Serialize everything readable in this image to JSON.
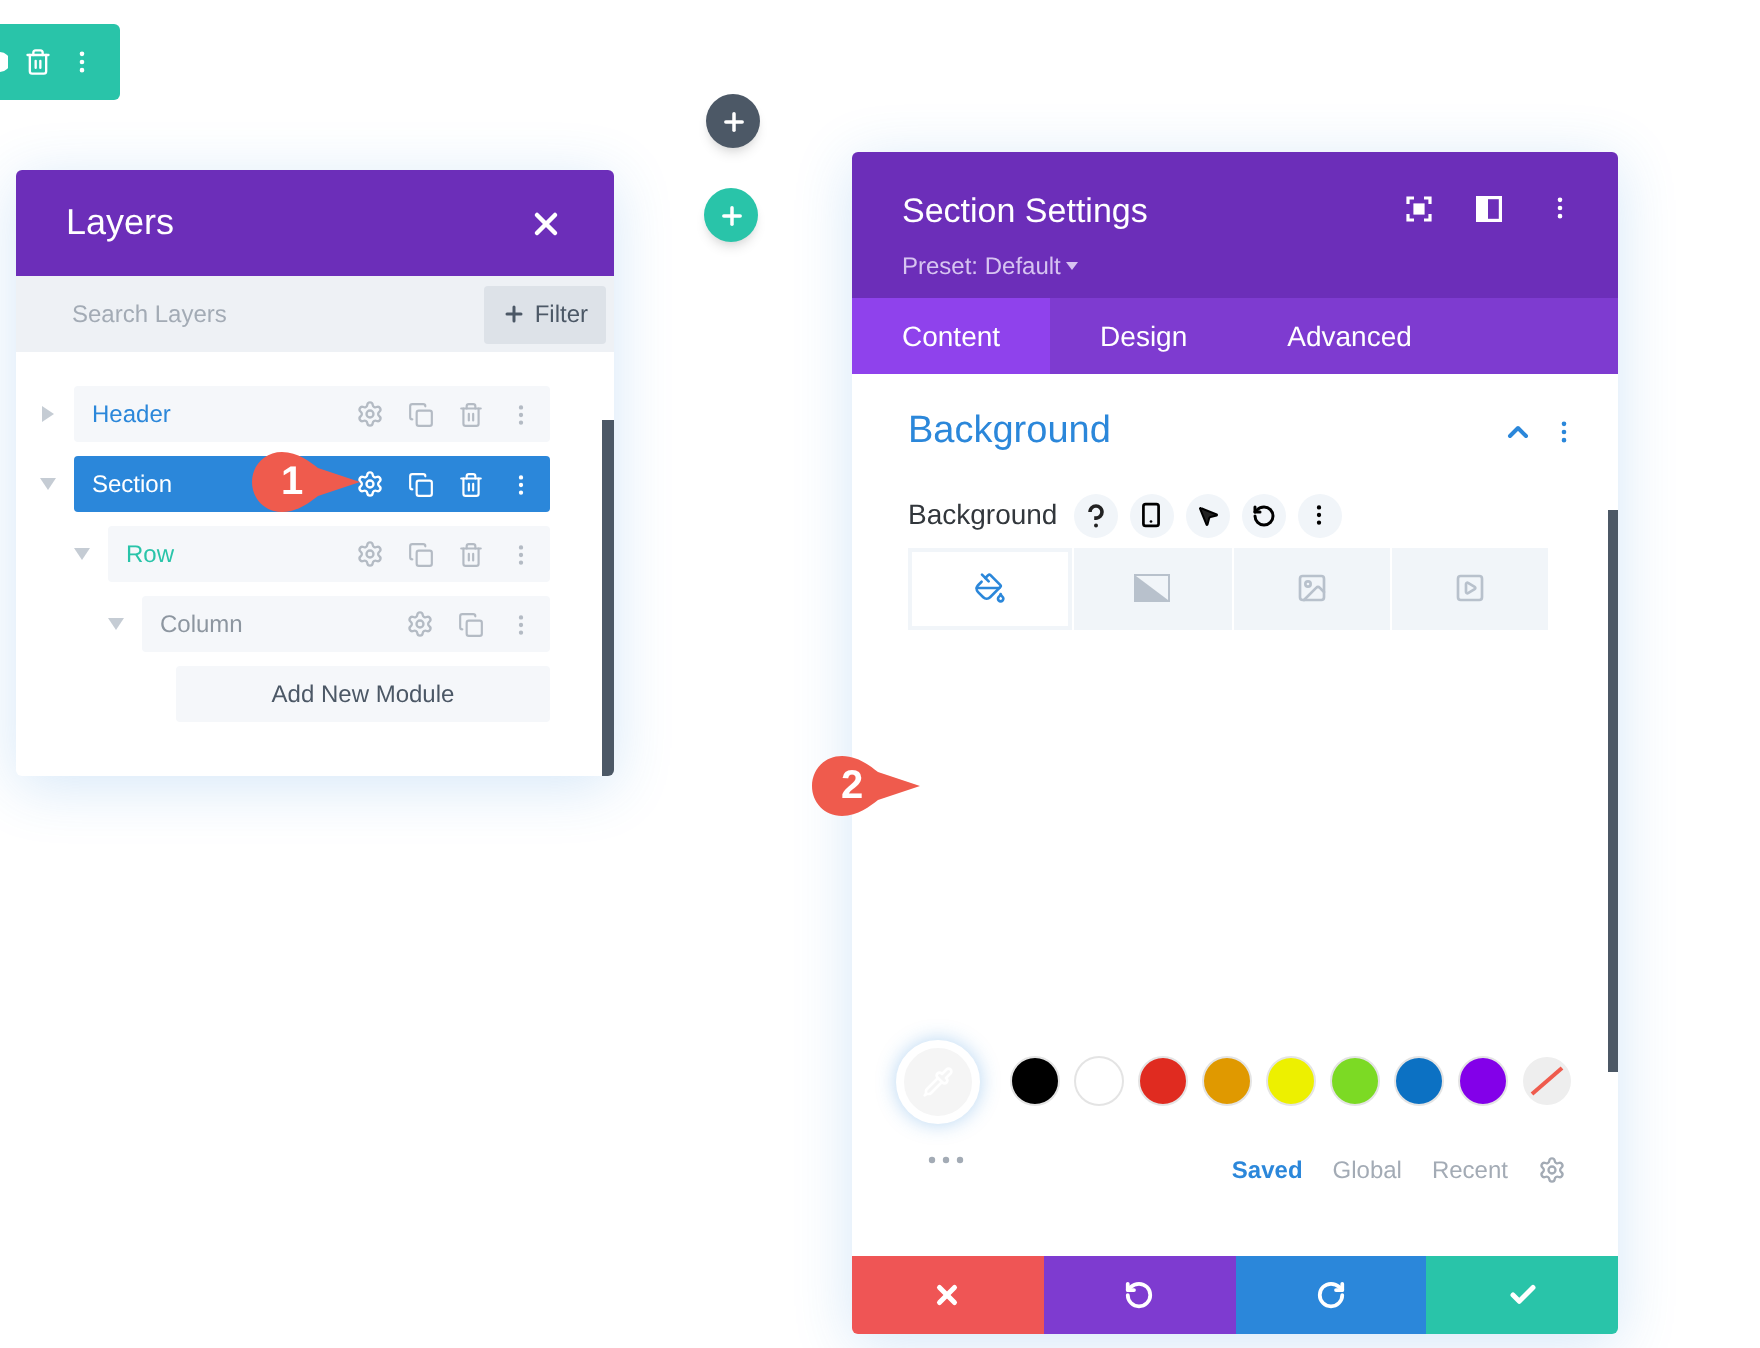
{
  "layers_panel": {
    "title": "Layers",
    "search": {
      "placeholder": "Search Layers"
    },
    "filter_button": "Filter",
    "tree": [
      {
        "label": "Header",
        "kind": "section",
        "selected": false,
        "expanded": false,
        "deletable": true
      },
      {
        "label": "Section",
        "kind": "section",
        "selected": true,
        "expanded": true,
        "deletable": true,
        "children": [
          {
            "label": "Row",
            "kind": "row",
            "selected": false,
            "expanded": true,
            "deletable": true,
            "children": [
              {
                "label": "Column",
                "kind": "column",
                "selected": false,
                "expanded": true,
                "deletable": false,
                "add_button": "Add New Module"
              }
            ]
          }
        ]
      }
    ]
  },
  "callouts": [
    {
      "label": "1"
    },
    {
      "label": "2"
    }
  ],
  "settings_panel": {
    "title": "Section Settings",
    "preset": "Preset: Default",
    "tabs": [
      {
        "label": "Content",
        "selected": true
      },
      {
        "label": "Design",
        "selected": false
      },
      {
        "label": "Advanced",
        "selected": false
      }
    ],
    "group": {
      "title": "Background",
      "expanded": true
    },
    "field_label": "Background",
    "background_types": [
      {
        "kind": "color",
        "selected": true
      },
      {
        "kind": "gradient",
        "selected": false
      },
      {
        "kind": "image",
        "selected": false
      },
      {
        "kind": "video",
        "selected": false
      }
    ],
    "swatches": [
      {
        "kind": "color",
        "color": "#000000"
      },
      {
        "kind": "color",
        "color": "#ffffff"
      },
      {
        "kind": "color",
        "color": "#e02b20"
      },
      {
        "kind": "color",
        "color": "#e09900"
      },
      {
        "kind": "color",
        "color": "#edf000"
      },
      {
        "kind": "color",
        "color": "#7cda24"
      },
      {
        "kind": "color",
        "color": "#0c71c3"
      },
      {
        "kind": "color",
        "color": "#8300e9"
      },
      {
        "kind": "none"
      }
    ],
    "palette_tabs": [
      {
        "label": "Saved",
        "selected": true
      },
      {
        "label": "Global",
        "selected": false
      },
      {
        "label": "Recent",
        "selected": false
      }
    ]
  }
}
